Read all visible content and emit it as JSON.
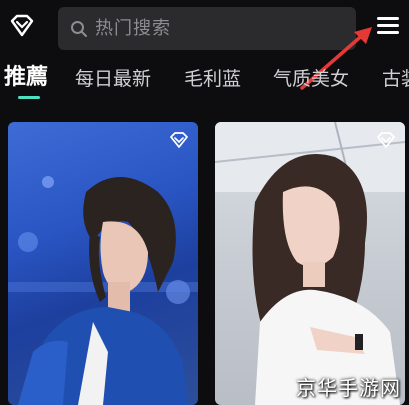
{
  "header": {
    "search_placeholder": "热门搜索",
    "logo_icon": "diamond-logo-icon",
    "menu_icon": "hamburger-menu-icon",
    "annotation": "red-arrow-pointing-to-menu"
  },
  "tabs": [
    {
      "label": "推薦",
      "active": true
    },
    {
      "label": "每日最新",
      "active": false
    },
    {
      "label": "毛利蓝",
      "active": false
    },
    {
      "label": "气质美女",
      "active": false
    },
    {
      "label": "古装",
      "active": false
    }
  ],
  "colors": {
    "background": "#0d0d0f",
    "search_bg": "#2b2b2e",
    "tab_indicator": "#4de1c0",
    "annotation_arrow": "#e53935"
  },
  "feed": [
    {
      "card": "photo-card-1",
      "badge_icon": "diamond-badge-icon"
    },
    {
      "card": "photo-card-2",
      "badge_icon": "diamond-badge-icon"
    }
  ],
  "watermark": "京华手游网"
}
